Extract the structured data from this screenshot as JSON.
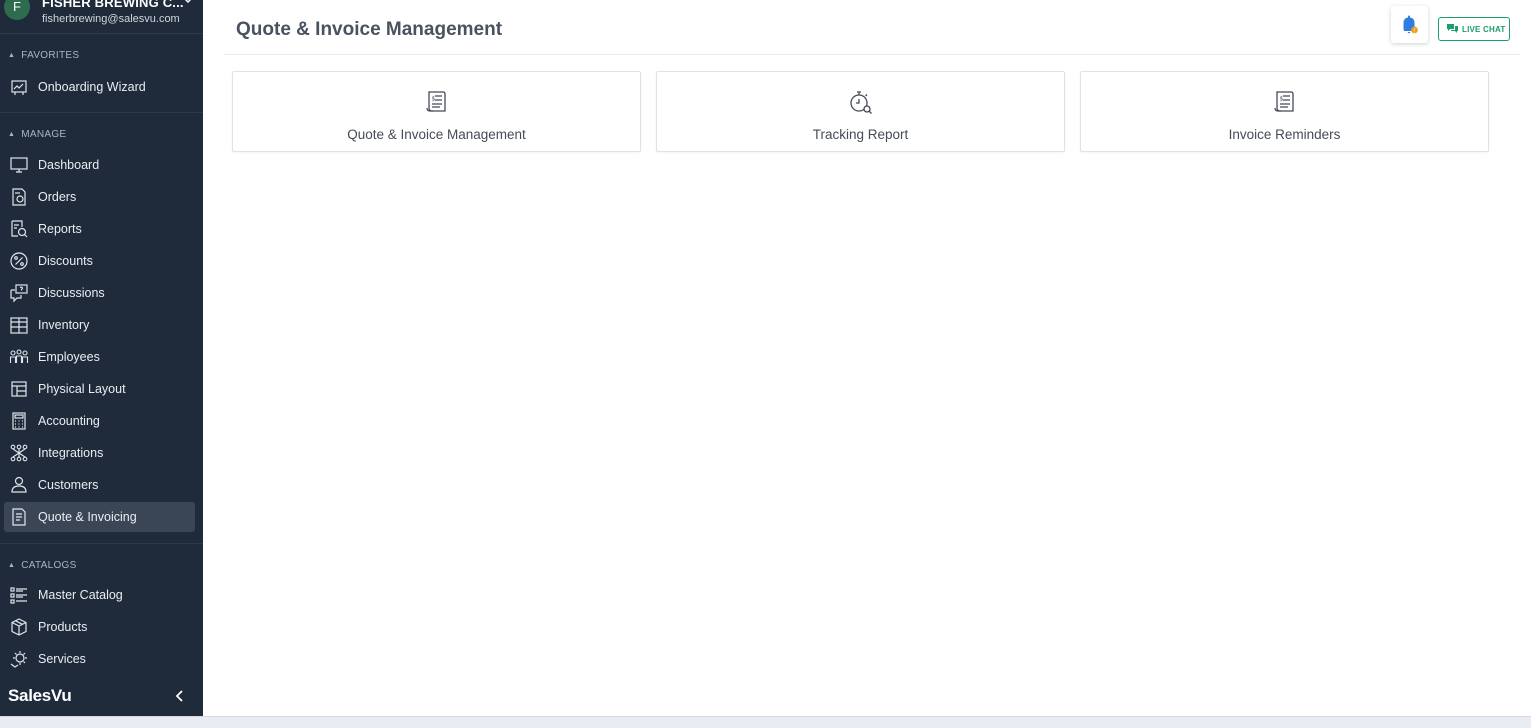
{
  "account": {
    "initial": "F",
    "name": "FISHER BREWING C...",
    "email": "fisherbrewing@salesvu.com"
  },
  "sections": {
    "favorites": "FAVORITES",
    "manage": "MANAGE",
    "catalogs": "CATALOGS"
  },
  "favorites": [
    {
      "label": "Onboarding Wizard",
      "icon": "wizard-icon"
    }
  ],
  "manage": [
    {
      "label": "Dashboard",
      "icon": "monitor-icon"
    },
    {
      "label": "Orders",
      "icon": "orders-icon"
    },
    {
      "label": "Reports",
      "icon": "reports-icon"
    },
    {
      "label": "Discounts",
      "icon": "percent-icon"
    },
    {
      "label": "Discussions",
      "icon": "chat-question-icon"
    },
    {
      "label": "Inventory",
      "icon": "inventory-icon"
    },
    {
      "label": "Employees",
      "icon": "people-icon"
    },
    {
      "label": "Physical Layout",
      "icon": "layout-icon"
    },
    {
      "label": "Accounting",
      "icon": "calculator-icon"
    },
    {
      "label": "Integrations",
      "icon": "integrations-icon"
    },
    {
      "label": "Customers",
      "icon": "customer-icon"
    },
    {
      "label": "Quote & Invoicing",
      "icon": "invoice-icon",
      "active": true
    }
  ],
  "catalogs": [
    {
      "label": "Master Catalog",
      "icon": "list-icon"
    },
    {
      "label": "Products",
      "icon": "box-icon"
    },
    {
      "label": "Services",
      "icon": "services-icon"
    }
  ],
  "brand": "SalesVu",
  "header": {
    "title": "Quote & Invoice Management",
    "live_chat": "LIVE CHAT"
  },
  "cards": [
    {
      "label": "Quote & Invoice Management",
      "icon": "receipt-icon"
    },
    {
      "label": "Tracking Report",
      "icon": "stopwatch-search-icon"
    },
    {
      "label": "Invoice Reminders",
      "icon": "receipt-icon"
    }
  ],
  "colors": {
    "sidebar_bg": "#1f2b3a",
    "active_item": "#3a4656",
    "accent_green": "#1e9e6a",
    "bell_blue": "#2f7de1",
    "badge_orange": "#f0a020"
  }
}
